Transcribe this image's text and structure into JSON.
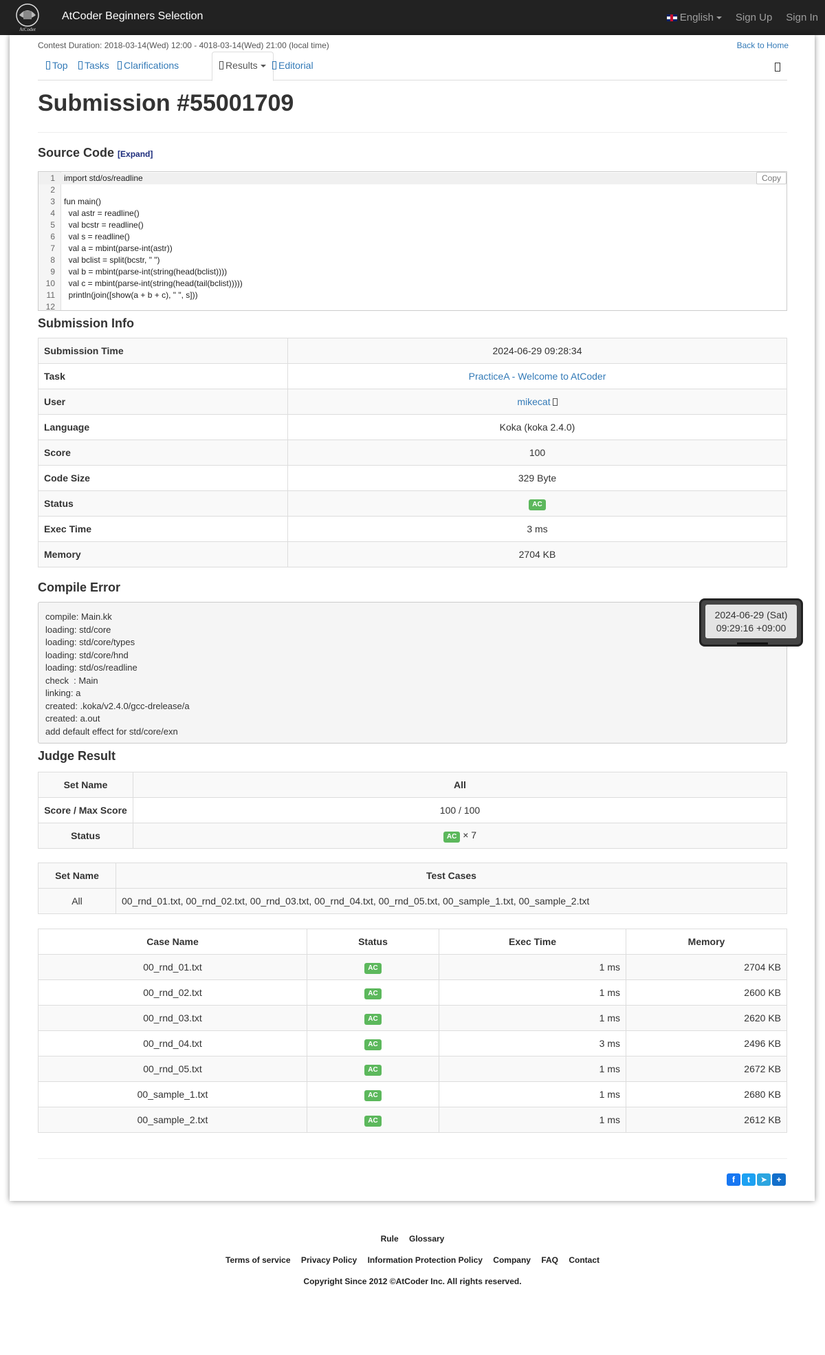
{
  "nav": {
    "brand": "AtCoder Beginners Selection",
    "logo_text": "AtCoder",
    "language": "English",
    "sign_up": "Sign Up",
    "sign_in": "Sign In"
  },
  "contest": {
    "duration": "Contest Duration: 2018-03-14(Wed) 12:00 - 4018-03-14(Wed) 21:00 (local time)",
    "back_home": "Back to Home"
  },
  "tabs": {
    "top": "Top",
    "tasks": "Tasks",
    "clarifications": "Clarifications",
    "results": "Results",
    "editorial": "Editorial"
  },
  "title": "Submission #55001709",
  "source": {
    "heading": "Source Code",
    "expand": "[Expand]",
    "copy": "Copy",
    "lines": [
      "import std/os/readline",
      "",
      "fun main()",
      "  val astr = readline()",
      "  val bcstr = readline()",
      "  val s = readline()",
      "  val a = mbint(parse-int(astr))",
      "  val bclist = split(bcstr, \" \")",
      "  val b = mbint(parse-int(string(head(bclist))))",
      "  val c = mbint(parse-int(string(head(tail(bclist)))))",
      "  println(join([show(a + b + c), \" \", s]))",
      ""
    ]
  },
  "info": {
    "heading": "Submission Info",
    "rows": [
      {
        "label": "Submission Time",
        "value": "2024-06-29 09:28:34"
      },
      {
        "label": "Task",
        "value": "PracticeA - Welcome to AtCoder"
      },
      {
        "label": "User",
        "value": "mikecat"
      },
      {
        "label": "Language",
        "value": "Koka (koka 2.4.0)"
      },
      {
        "label": "Score",
        "value": "100"
      },
      {
        "label": "Code Size",
        "value": "329 Byte"
      },
      {
        "label": "Status",
        "value": "AC"
      },
      {
        "label": "Exec Time",
        "value": "3 ms"
      },
      {
        "label": "Memory",
        "value": "2704 KB"
      }
    ]
  },
  "compile": {
    "heading": "Compile Error",
    "lines": [
      "compile: Main.kk",
      "loading: std/core",
      "loading: std/core/types",
      "loading: std/core/hnd",
      "loading: std/os/readline",
      "check  : Main",
      "linking: a",
      "created: .koka/v2.4.0/gcc-drelease/a",
      "created: a.out",
      "add default effect for std/core/exn"
    ]
  },
  "tooltip": {
    "date": "2024-06-29 (Sat)",
    "time": "09:29:16 +09:00"
  },
  "judge": {
    "heading": "Judge Result",
    "set_name_label": "Set Name",
    "set_name_value": "All",
    "score_label": "Score / Max Score",
    "score_value": "100 / 100",
    "status_label": "Status",
    "status_badge": "AC",
    "status_count": "× 7"
  },
  "sets": {
    "headers": [
      "Set Name",
      "Test Cases"
    ],
    "rows": [
      {
        "name": "All",
        "cases": "00_rnd_01.txt, 00_rnd_02.txt, 00_rnd_03.txt, 00_rnd_04.txt, 00_rnd_05.txt, 00_sample_1.txt, 00_sample_2.txt"
      }
    ]
  },
  "cases": {
    "headers": [
      "Case Name",
      "Status",
      "Exec Time",
      "Memory"
    ],
    "rows": [
      {
        "name": "00_rnd_01.txt",
        "status": "AC",
        "time": "1 ms",
        "memory": "2704 KB"
      },
      {
        "name": "00_rnd_02.txt",
        "status": "AC",
        "time": "1 ms",
        "memory": "2600 KB"
      },
      {
        "name": "00_rnd_03.txt",
        "status": "AC",
        "time": "1 ms",
        "memory": "2620 KB"
      },
      {
        "name": "00_rnd_04.txt",
        "status": "AC",
        "time": "3 ms",
        "memory": "2496 KB"
      },
      {
        "name": "00_rnd_05.txt",
        "status": "AC",
        "time": "1 ms",
        "memory": "2672 KB"
      },
      {
        "name": "00_sample_1.txt",
        "status": "AC",
        "time": "1 ms",
        "memory": "2680 KB"
      },
      {
        "name": "00_sample_2.txt",
        "status": "AC",
        "time": "1 ms",
        "memory": "2612 KB"
      }
    ]
  },
  "footer": {
    "rule": "Rule",
    "glossary": "Glossary",
    "terms": "Terms of service",
    "privacy": "Privacy Policy",
    "info_protection": "Information Protection Policy",
    "company": "Company",
    "faq": "FAQ",
    "contact": "Contact",
    "copyright": "Copyright Since 2012 ©AtCoder Inc. All rights reserved."
  },
  "colors": {
    "navbar": "#222222",
    "link": "#337ab7",
    "ac_badge": "#5cb85c"
  }
}
